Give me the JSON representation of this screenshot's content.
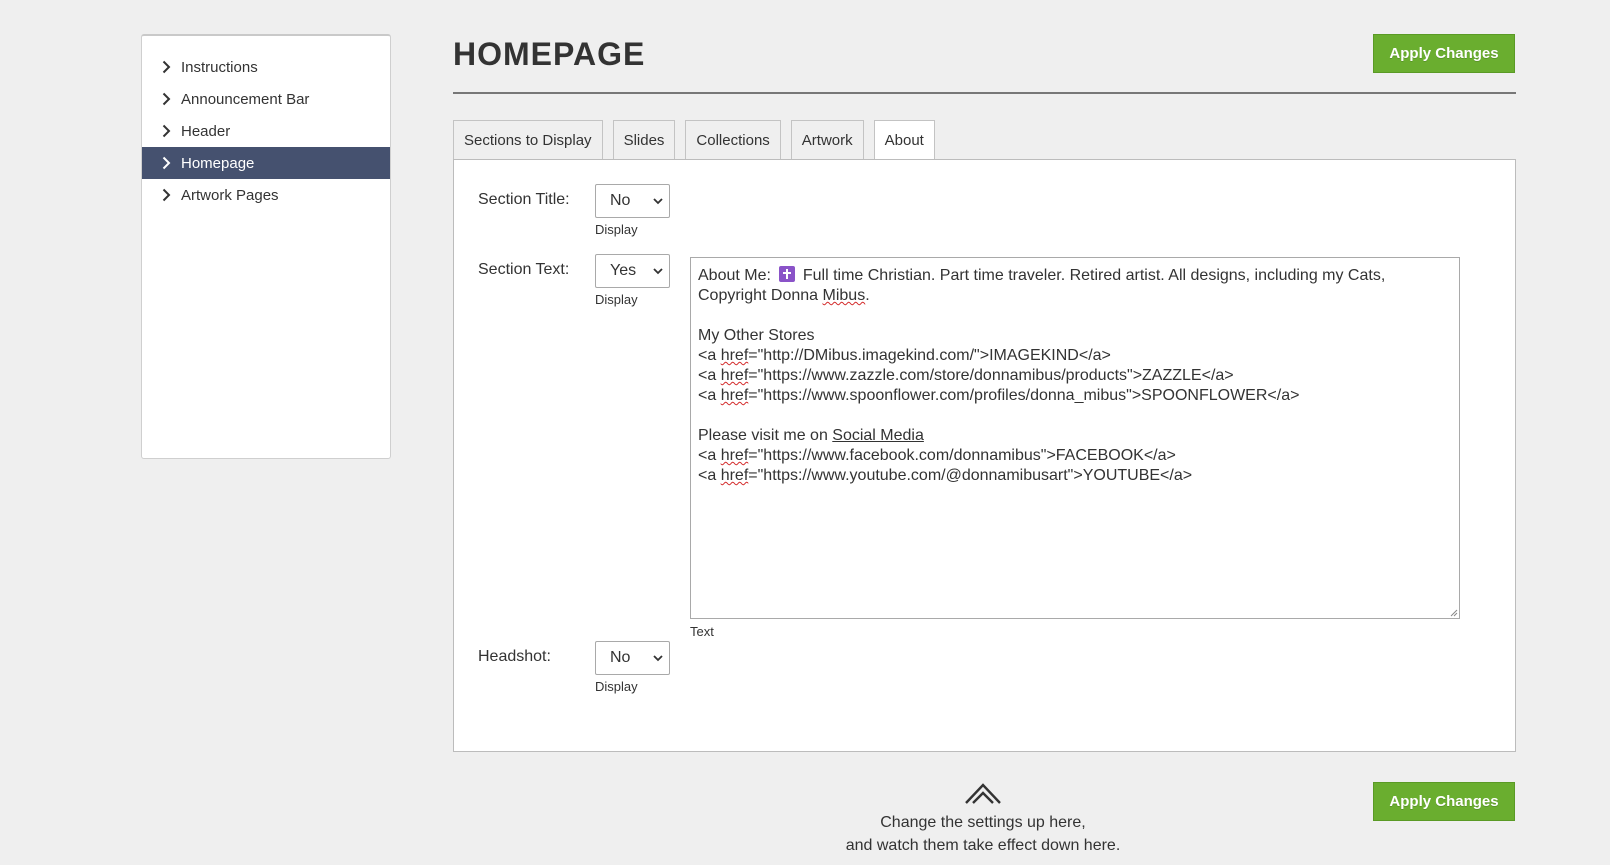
{
  "sidebar": {
    "items": [
      {
        "label": "Instructions"
      },
      {
        "label": "Announcement Bar"
      },
      {
        "label": "Header"
      },
      {
        "label": "Homepage",
        "active": true
      },
      {
        "label": "Artwork Pages"
      }
    ]
  },
  "page": {
    "title": "HOMEPAGE",
    "apply_label": "Apply Changes"
  },
  "tabs": [
    {
      "label": "Sections to Display"
    },
    {
      "label": "Slides"
    },
    {
      "label": "Collections"
    },
    {
      "label": "Artwork"
    },
    {
      "label": "About",
      "active": true
    }
  ],
  "form": {
    "section_title": {
      "label": "Section Title:",
      "value": "No",
      "sub": "Display"
    },
    "section_text": {
      "label": "Section Text:",
      "value": "Yes",
      "sub": "Display"
    },
    "text": {
      "sub": "Text",
      "line1_a": "About Me:",
      "line1_b": "Full time Christian. Part time traveler. Retired artist. All designs, including my Cats,",
      "line2_a": "Copyright Donna ",
      "line2_b": "Mibus",
      "line2_c": ".",
      "line4": "My Other Stores",
      "link1": "\"http://DMibus.imagekind.com/\">IMAGEKIND</a>",
      "link2": "\"https://www.zazzle.com/store/donnamibus/products\">ZAZZLE</a>",
      "link3": "\"https://www.spoonflower.com/profiles/donna_mibus\">SPOONFLOWER</a>",
      "line9_a": "Please visit me on ",
      "line9_b": "Social Media",
      "link4": "\"https://www.facebook.com/donnamibus\">FACEBOOK</a>",
      "link5": "\"https://www.youtube.com/@donnamibusart\">YOUTUBE</a>",
      "anchor_open": "<a ",
      "href": "href",
      "eq": "="
    },
    "headshot": {
      "label": "Headshot:",
      "value": "No",
      "sub": "Display"
    }
  },
  "footer": {
    "line1": "Change the settings up here,",
    "line2": "and watch them take effect down here."
  },
  "colors": {
    "sidebar_active": "#45516f",
    "apply_button": "#6aae2f"
  }
}
